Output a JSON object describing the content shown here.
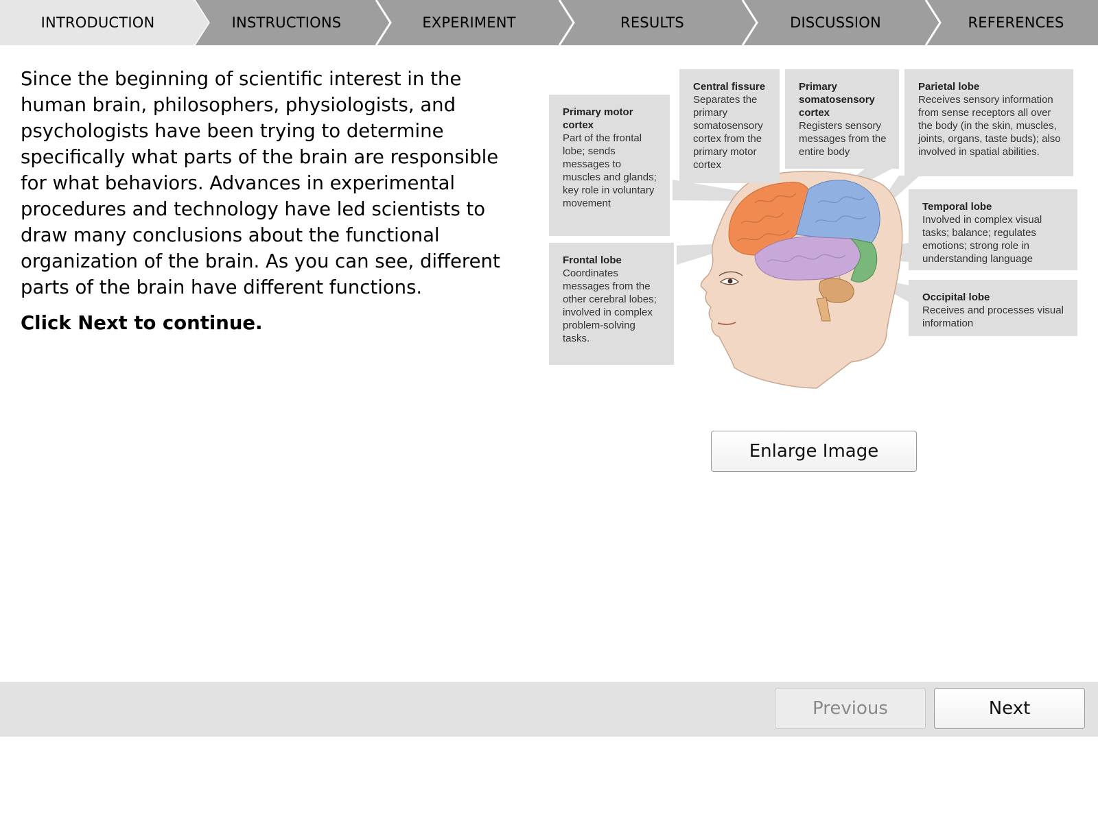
{
  "steps": [
    {
      "label": "INTRODUCTION",
      "active": true
    },
    {
      "label": "INSTRUCTIONS",
      "active": false
    },
    {
      "label": "EXPERIMENT",
      "active": false
    },
    {
      "label": "RESULTS",
      "active": false
    },
    {
      "label": "DISCUSSION",
      "active": false
    },
    {
      "label": "REFERENCES",
      "active": false
    }
  ],
  "intro": {
    "paragraph": "Since the beginning of scientific interest in the human brain, philosophers, physiologists, and psychologists have been trying to determine specifically what parts of the brain are responsible for what behaviors. Advances in experimental procedures and technology have led scientists to draw many conclusions about the functional organization of the brain. As you can see, different parts of the brain have different functions.",
    "cta": "Click Next to continue."
  },
  "figure": {
    "callouts": {
      "primary_motor": {
        "title": "Primary motor cortex",
        "desc": "Part of the frontal lobe; sends messages to muscles and glands; key role in voluntary movement"
      },
      "frontal": {
        "title": "Frontal lobe",
        "desc": "Coordinates messages from the other cerebral lobes; involved in complex problem-solving tasks."
      },
      "central_fissure": {
        "title": "Central fissure",
        "desc": "Separates the primary somatosensory cortex from the primary motor cortex"
      },
      "somatosensory": {
        "title": "Primary somatosensory cortex",
        "desc": "Registers sensory messages from the entire body"
      },
      "parietal": {
        "title": "Parietal lobe",
        "desc": "Receives sensory information from sense receptors all over the body (in the skin, muscles, joints, organs, taste buds); also involved in spatial abilities."
      },
      "temporal": {
        "title": "Temporal lobe",
        "desc": "Involved in complex visual tasks; balance; regulates emotions; strong role in understanding language"
      },
      "occipital": {
        "title": "Occipital lobe",
        "desc": "Receives and processes visual information"
      }
    },
    "colors": {
      "frontal": "#f08a50",
      "parietal": "#8fb0e0",
      "temporal": "#c8a8d8",
      "occipital": "#7ab77a",
      "cerebellum": "#d9a470",
      "skin": "#f2d8c4"
    },
    "enlarge_label": "Enlarge Image"
  },
  "footer": {
    "previous_label": "Previous",
    "next_label": "Next"
  }
}
